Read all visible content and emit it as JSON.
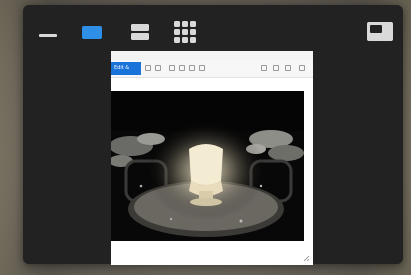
{
  "switcher": {
    "layouts": [
      {
        "name": "minimize",
        "active": false
      },
      {
        "name": "single",
        "active": true
      },
      {
        "name": "stacked",
        "active": false
      },
      {
        "name": "grid",
        "active": false
      }
    ],
    "corner_layout": "snap-corner"
  },
  "preview": {
    "window_title": "",
    "toolbar": {
      "edit_label": "Edit & Create"
    },
    "image_description_icon": "photo-lantern-in-snow"
  },
  "colors": {
    "accent": "#2f8fe6",
    "panel": "#222222",
    "icon": "#d9d9d9"
  }
}
